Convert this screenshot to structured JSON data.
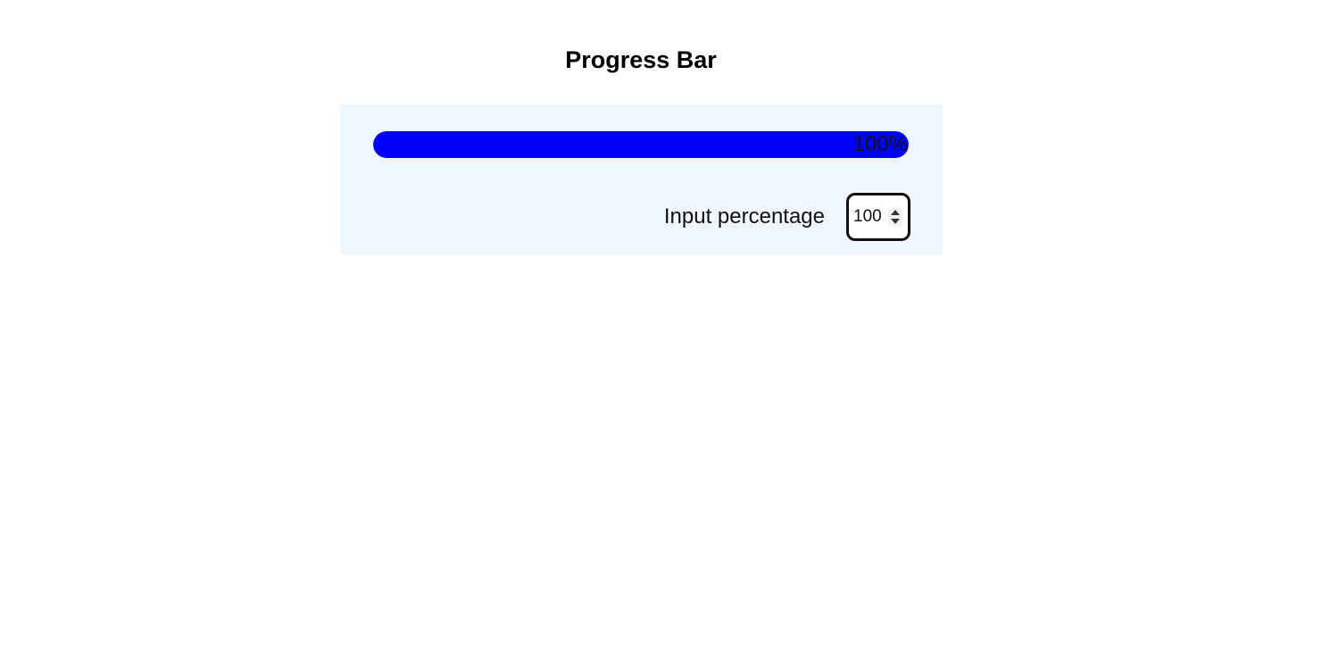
{
  "page": {
    "title": "Progress Bar"
  },
  "progress": {
    "value": 100,
    "label": "100%",
    "fill_color": "#0000ff",
    "track_color": "#e8e8e8"
  },
  "input": {
    "label": "Input percentage",
    "value": "100"
  },
  "colors": {
    "panel_background": "#eff6fd",
    "page_background": "#ffffff"
  },
  "icons": {
    "spinner_up": "chevron-up-icon",
    "spinner_down": "chevron-down-icon"
  }
}
